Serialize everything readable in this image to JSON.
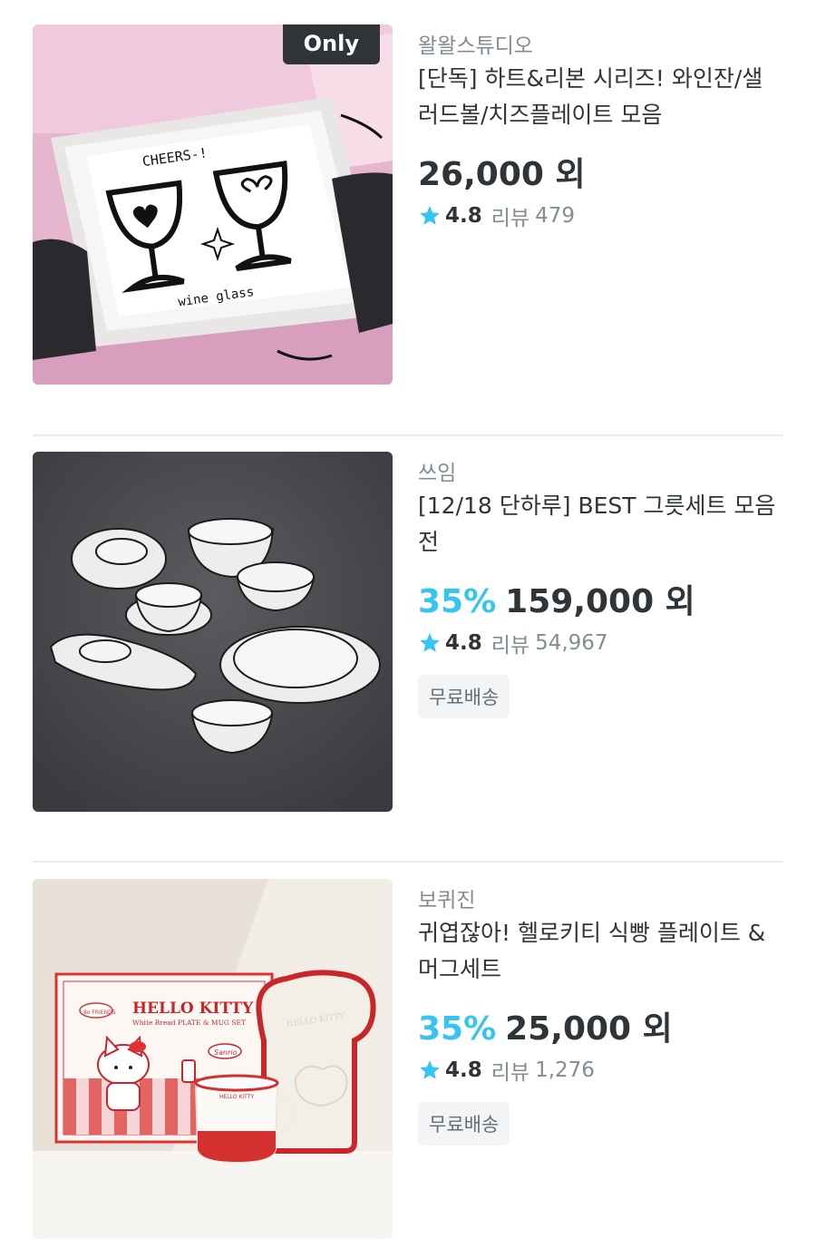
{
  "products": [
    {
      "brand": "왈왈스튜디오",
      "title": "[단독] 하트&리본 시리즈! 와인잔/샐러드볼/치즈플레이트 모음",
      "badge": "Only",
      "discount": "",
      "price": "26,000 외",
      "rating": "4.8",
      "review_label": "리뷰",
      "review_count": "479",
      "image_text": {
        "top": "CHEERS-!",
        "bottom": "wine glass"
      }
    },
    {
      "brand": "쓰임",
      "title": "[12/18 단하루] BEST 그릇세트 모음전",
      "badge": "",
      "discount": "35%",
      "price": "159,000 외",
      "rating": "4.8",
      "review_label": "리뷰",
      "review_count": "54,967",
      "tag": "무료배송"
    },
    {
      "brand": "보퀴진",
      "title": "귀엽잖아! 헬로키티 식빵 플레이트 & 머그세트",
      "badge": "",
      "discount": "35%",
      "price": "25,000 외",
      "rating": "4.8",
      "review_label": "리뷰",
      "review_count": "1,276",
      "tag": "무료배송",
      "image_text": {
        "box_title": "HELLO KITTY",
        "box_subtitle": "White Bread PLATE & MUG SET",
        "box_sticker": "8o FRIENDS",
        "mug_label": "HELLO KITTY",
        "plate_label": "HELLO KITTY",
        "box_logo": "Sanrio"
      }
    }
  ],
  "colors": {
    "accent": "#35c5f0",
    "text": "#2f3438",
    "muted": "#828c94",
    "star": "#35c5f0",
    "tag_bg": "#f2f4f6"
  },
  "icons": {
    "rating": "star-icon"
  }
}
